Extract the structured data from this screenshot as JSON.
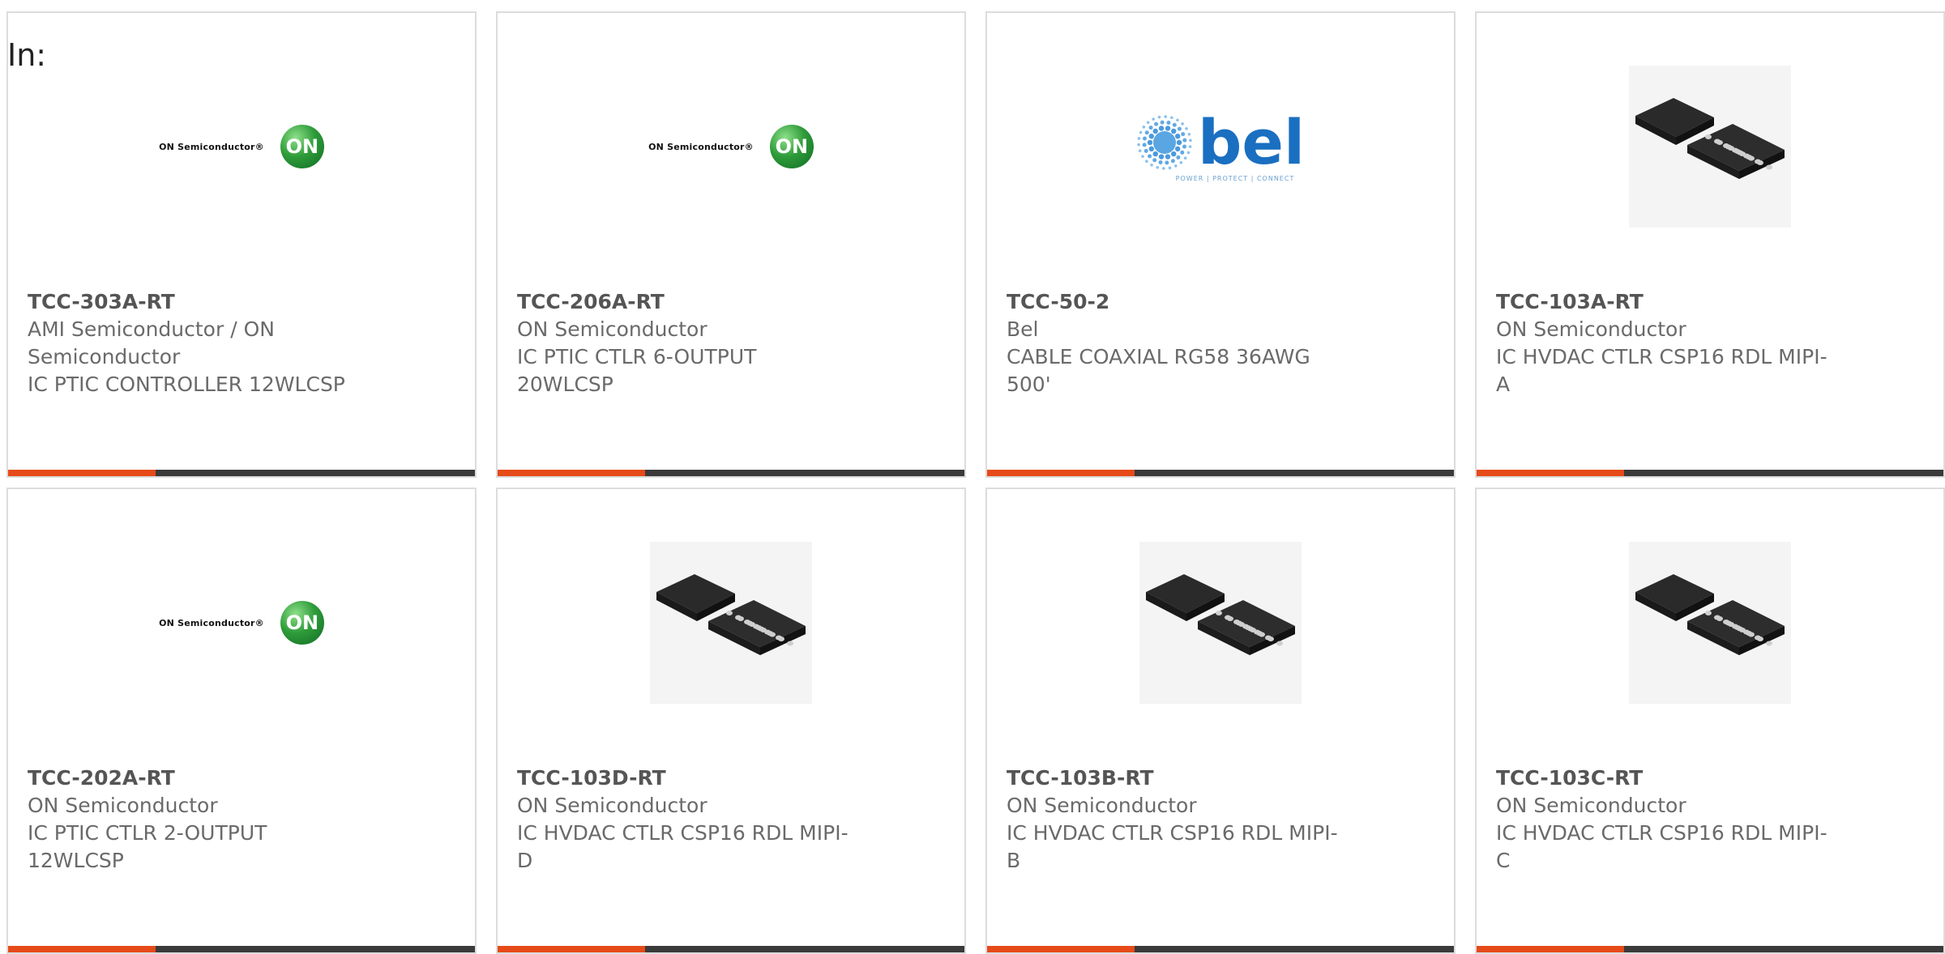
{
  "filter_label": "In:",
  "colors": {
    "accent_orange": "#e64a19",
    "accent_dark": "#3a3a3a",
    "card_border": "#dcdcdc"
  },
  "cards": [
    {
      "part": "TCC-303A-RT",
      "manufacturer": "AMI Semiconductor / ON Semiconductor",
      "description": "IC PTIC CONTROLLER 12WLCSP",
      "image": "on-semiconductor-logo",
      "logo_text": "ON Semiconductor®",
      "logo_mark": "ON"
    },
    {
      "part": "TCC-206A-RT",
      "manufacturer": "ON Semiconductor",
      "description": "IC PTIC CTLR 6-OUTPUT 20WLCSP",
      "image": "on-semiconductor-logo",
      "logo_text": "ON Semiconductor®",
      "logo_mark": "ON"
    },
    {
      "part": "TCC-50-2",
      "manufacturer": "Bel",
      "description": "CABLE COAXIAL RG58 36AWG 500'",
      "image": "bel-logo",
      "logo_text": "bel",
      "logo_tagline": "POWER | PROTECT | CONNECT"
    },
    {
      "part": "TCC-103A-RT",
      "manufacturer": "ON Semiconductor",
      "description": "IC HVDAC CTLR CSP16 RDL MIPI-A",
      "image": "chip-package-photo"
    },
    {
      "part": "TCC-202A-RT",
      "manufacturer": "ON Semiconductor",
      "description": "IC PTIC CTLR 2-OUTPUT 12WLCSP",
      "image": "on-semiconductor-logo",
      "logo_text": "ON Semiconductor®",
      "logo_mark": "ON"
    },
    {
      "part": "TCC-103D-RT",
      "manufacturer": "ON Semiconductor",
      "description": "IC HVDAC CTLR CSP16 RDL MIPI-D",
      "image": "chip-package-photo"
    },
    {
      "part": "TCC-103B-RT",
      "manufacturer": "ON Semiconductor",
      "description": "IC HVDAC CTLR CSP16 RDL MIPI-B",
      "image": "chip-package-photo"
    },
    {
      "part": "TCC-103C-RT",
      "manufacturer": "ON Semiconductor",
      "description": "IC HVDAC CTLR CSP16 RDL MIPI-C",
      "image": "chip-package-photo"
    }
  ]
}
